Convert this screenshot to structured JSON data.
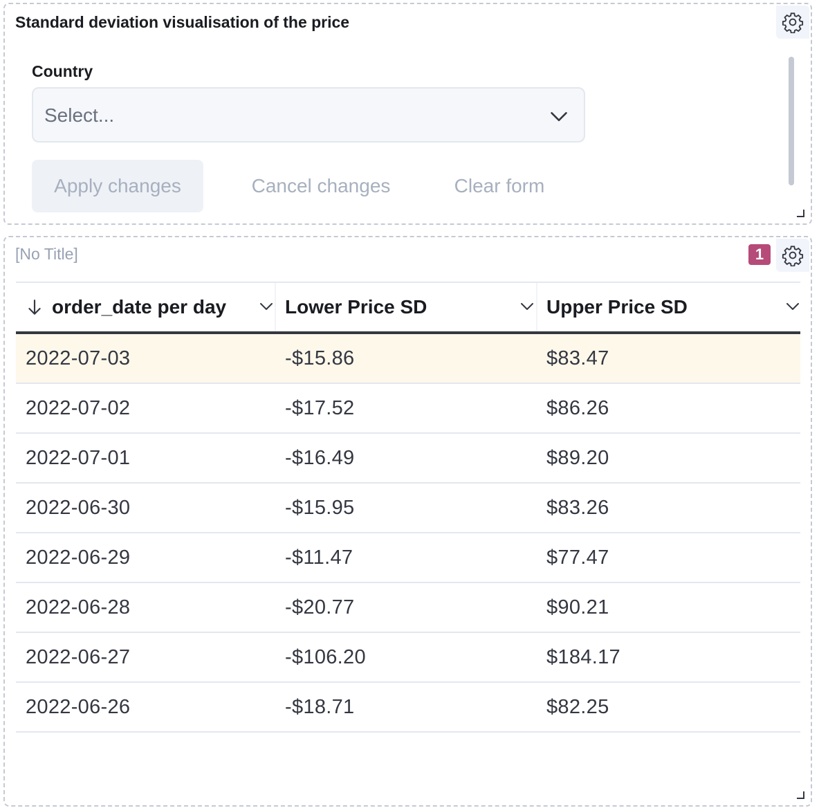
{
  "controls_panel": {
    "title": "Standard deviation visualisation of the price",
    "country_label": "Country",
    "country_placeholder": "Select...",
    "apply_label": "Apply changes",
    "cancel_label": "Cancel changes",
    "clear_label": "Clear form"
  },
  "table_panel": {
    "title": "[No Title]",
    "badge_count": "1",
    "columns": [
      "order_date per day",
      "Lower Price SD",
      "Upper Price SD"
    ],
    "rows": [
      [
        "2022-07-03",
        "-$15.86",
        "$83.47"
      ],
      [
        "2022-07-02",
        "-$17.52",
        "$86.26"
      ],
      [
        "2022-07-01",
        "-$16.49",
        "$89.20"
      ],
      [
        "2022-06-30",
        "-$15.95",
        "$83.26"
      ],
      [
        "2022-06-29",
        "-$11.47",
        "$77.47"
      ],
      [
        "2022-06-28",
        "-$20.77",
        "$90.21"
      ],
      [
        "2022-06-27",
        "-$106.20",
        "$184.17"
      ],
      [
        "2022-06-26",
        "-$18.71",
        "$82.25"
      ]
    ]
  },
  "colors": {
    "badge": "#b64b7a",
    "highlight_row": "#fdf8ea",
    "panel_border": "#c4c9d3"
  },
  "icons": [
    "gear-icon",
    "chevron-down-icon",
    "arrow-down-icon",
    "resize-handle-icon"
  ]
}
